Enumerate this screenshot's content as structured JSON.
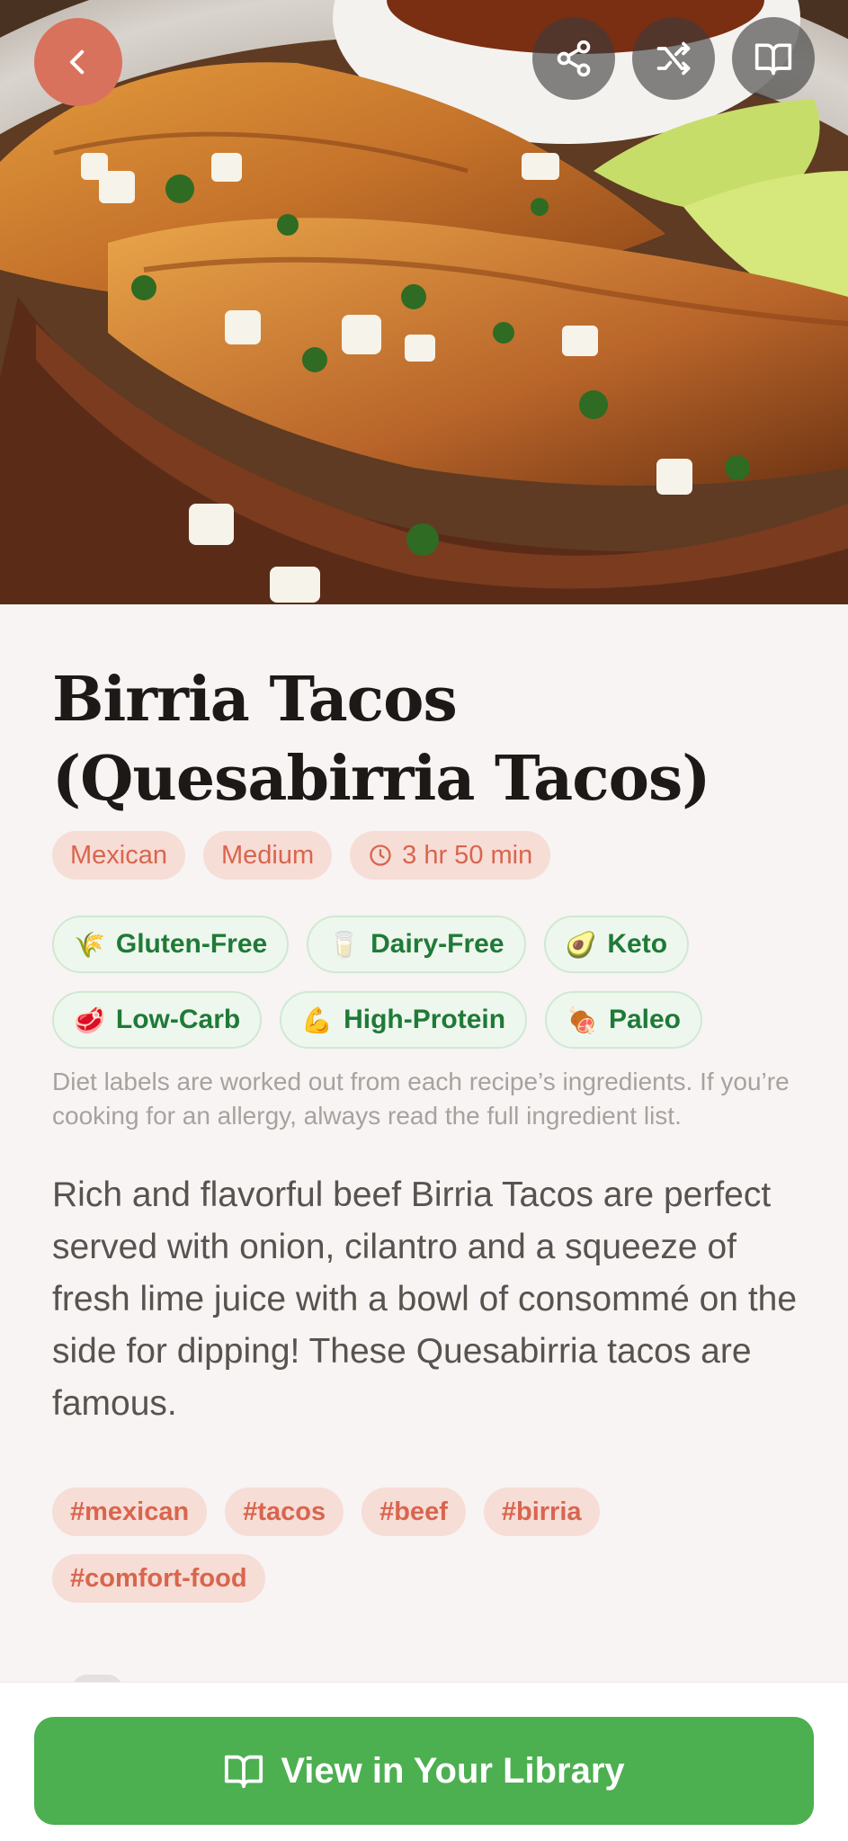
{
  "recipe": {
    "title": "Birria Tacos (Quesabirria Tacos)",
    "cuisine": "Mexican",
    "difficulty": "Medium",
    "total_time": "3 hr 50 min",
    "diet_labels": [
      {
        "emoji": "🌾",
        "label": "Gluten-Free"
      },
      {
        "emoji": "🥛",
        "label": "Dairy-Free"
      },
      {
        "emoji": "🥑",
        "label": "Keto"
      },
      {
        "emoji": "🥩",
        "label": "Low-Carb"
      },
      {
        "emoji": "💪",
        "label": "High-Protein"
      },
      {
        "emoji": "🍖",
        "label": "Paleo"
      }
    ],
    "diet_note": "Diet labels are worked out from each recipe’s ingredients. If you’re cooking for an allergy, always read the full ingredient list.",
    "description": "Rich and flavorful beef Birria Tacos are perfect served with onion, cilantro and a squeeze of fresh lime juice with a bowl of consommé on the side for dipping! These Quesabirria tacos are famous.",
    "tags": [
      "#mexican",
      "#tacos",
      "#beef",
      "#birria",
      "#comfort-food"
    ]
  },
  "actions": {
    "primary_label": "View in Your Library"
  },
  "colors": {
    "accent": "#d9725c",
    "primary_green": "#4caf50",
    "diet_green": "#1f7a37",
    "pill_bg": "#f6ddd6"
  },
  "icons": {
    "back": "chevron-left-icon",
    "share": "share-icon",
    "shuffle": "shuffle-icon",
    "library": "book-open-icon",
    "time": "clock-icon"
  }
}
